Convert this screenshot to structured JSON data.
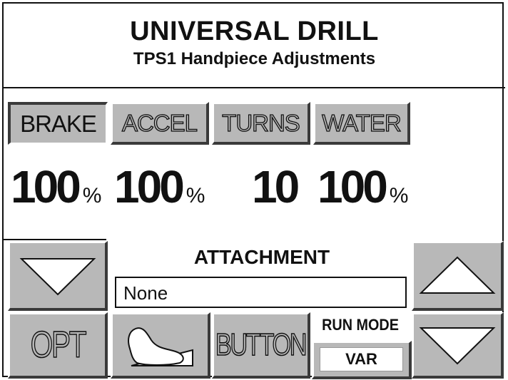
{
  "header": {
    "title": "UNIVERSAL DRILL",
    "subtitle": "TPS1 Handpiece Adjustments"
  },
  "tabs": [
    {
      "label": "BRAKE",
      "active": true
    },
    {
      "label": "ACCEL",
      "active": false
    },
    {
      "label": "TURNS",
      "active": false
    },
    {
      "label": "WATER",
      "active": false
    }
  ],
  "values": {
    "brake": {
      "number": "100",
      "unit": "%"
    },
    "accel": {
      "number": "100",
      "unit": "%"
    },
    "turns": {
      "number": "10",
      "unit": ""
    },
    "water": {
      "number": "100",
      "unit": "%"
    }
  },
  "attachment": {
    "label": "ATTACHMENT",
    "value": "None"
  },
  "buttons": {
    "opt_label": "OPT",
    "button_label": "BUTTON",
    "run_mode_label": "RUN MODE",
    "run_mode_value": "VAR"
  },
  "icons": {
    "left_down": "down-arrow-icon",
    "right_up": "up-arrow-icon",
    "right_down": "down-arrow-icon",
    "foot_pedal": "foot-pedal-icon"
  },
  "colors": {
    "button_face": "#b8b8b8",
    "shadow": "#3a3a3a",
    "highlight": "#ffffff"
  }
}
